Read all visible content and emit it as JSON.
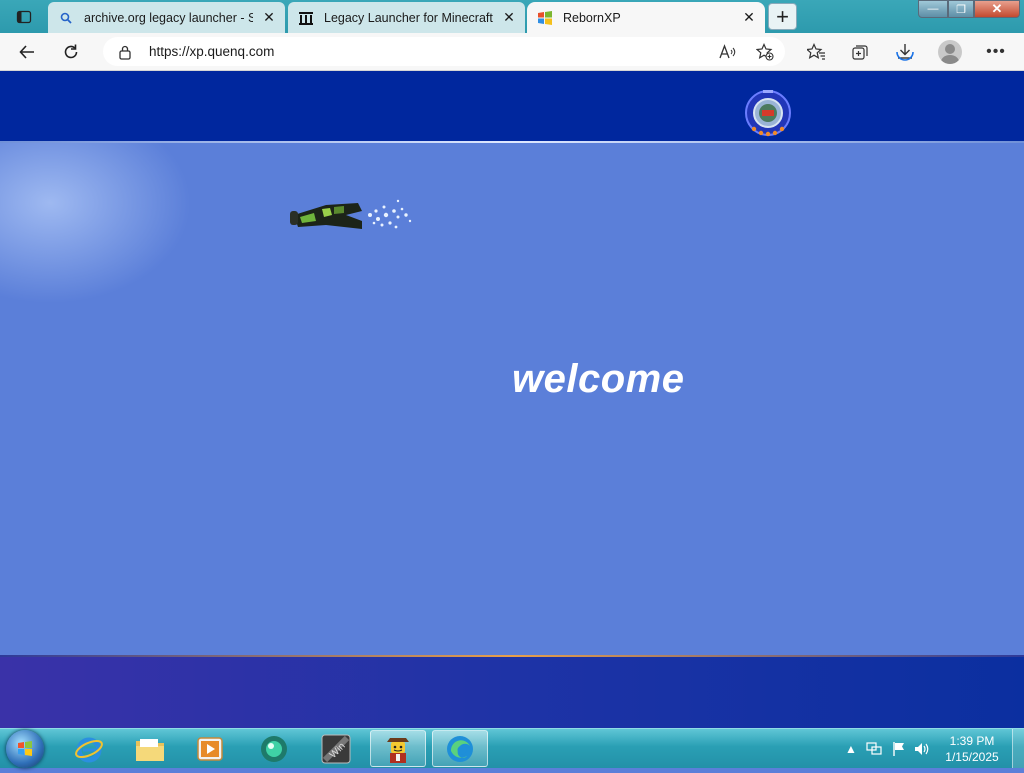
{
  "browser": {
    "tabs": [
      {
        "title": "archive.org legacy launcher - Sea",
        "close": "✕",
        "icon": "search-icon"
      },
      {
        "title": "Legacy Launcher for Minecraft : ",
        "close": "✕",
        "icon": "archive-icon"
      },
      {
        "title": "RebornXP",
        "close": "✕",
        "icon": "windows-flag-icon",
        "active": true
      }
    ],
    "new_tab_label": "+",
    "window_controls": {
      "minimize": "—",
      "maximize": "❐",
      "close": "✕"
    },
    "address": {
      "url": "https://xp.quenq.com"
    },
    "toolbar_icons": [
      "back-icon",
      "refresh-icon",
      "lock-icon",
      "read-aloud-icon",
      "add-favorite-icon",
      "favorites-icon",
      "collections-icon",
      "downloads-icon",
      "profile-icon",
      "more-icon"
    ]
  },
  "page": {
    "welcome_text": "welcome",
    "colors": {
      "header": "#00279e",
      "main": "#5b7fd9",
      "footer": "#1e33a6"
    }
  },
  "taskbar": {
    "apps": [
      "start-orb-icon",
      "internet-explorer-icon",
      "file-explorer-icon",
      "media-player-icon",
      "app-circle-icon",
      "win-badge-icon",
      "lego-figure-icon",
      "edge-icon"
    ],
    "clock": {
      "time": "1:39 PM",
      "date": "1/15/2025"
    }
  }
}
